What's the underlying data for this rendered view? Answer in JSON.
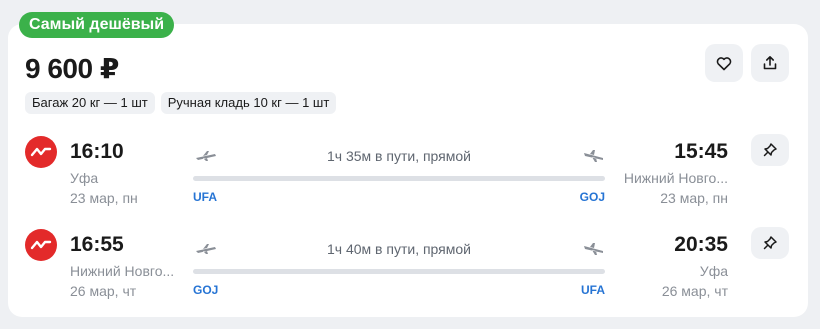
{
  "badge": {
    "label": "Самый дешёвый",
    "color": "#3bb14a"
  },
  "price": "9 600 ₽",
  "chips": [
    "Багаж 20 кг — 1 шт",
    "Ручная кладь 10 кг — 1 шт"
  ],
  "actions": {
    "favorite_icon": "heart-icon",
    "share_icon": "share-icon"
  },
  "segments": [
    {
      "airline_logo": "airline-logo-icon",
      "dep_time": "16:10",
      "dep_city": "Уфа",
      "dep_date": "23 мар, пн",
      "duration": "1ч 35м в пути, прямой",
      "dep_code": "UFA",
      "arr_code": "GOJ",
      "arr_time": "15:45",
      "arr_city": "Нижний Новго...",
      "arr_date": "23 мар, пн"
    },
    {
      "airline_logo": "airline-logo-icon",
      "dep_time": "16:55",
      "dep_city": "Нижний Новго...",
      "dep_date": "26 мар, чт",
      "duration": "1ч 40м в пути, прямой",
      "dep_code": "GOJ",
      "arr_code": "UFA",
      "arr_time": "20:35",
      "arr_city": "Уфа",
      "arr_date": "26 мар, чт"
    }
  ],
  "colors": {
    "accent_blue": "#2674d4",
    "airline_red": "#e32a2a"
  }
}
